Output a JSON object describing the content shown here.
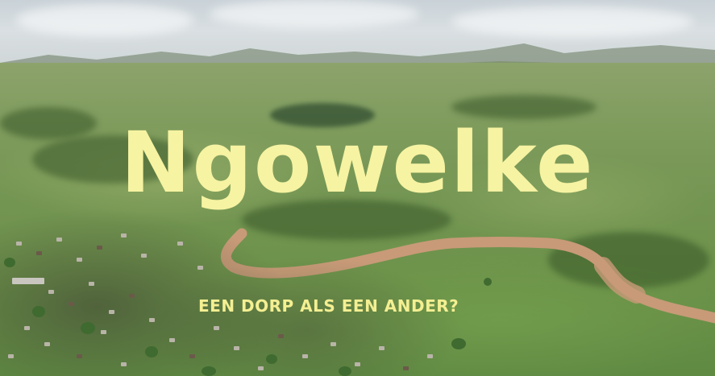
{
  "title": "Ngowelke",
  "subtitle": "EEN DORP ALS EEN ANDER?",
  "colors": {
    "title_text": "#f6f3a2",
    "subtitle_text": "#f4ef92",
    "river": "#c89a78",
    "vegetation": "#739552"
  }
}
